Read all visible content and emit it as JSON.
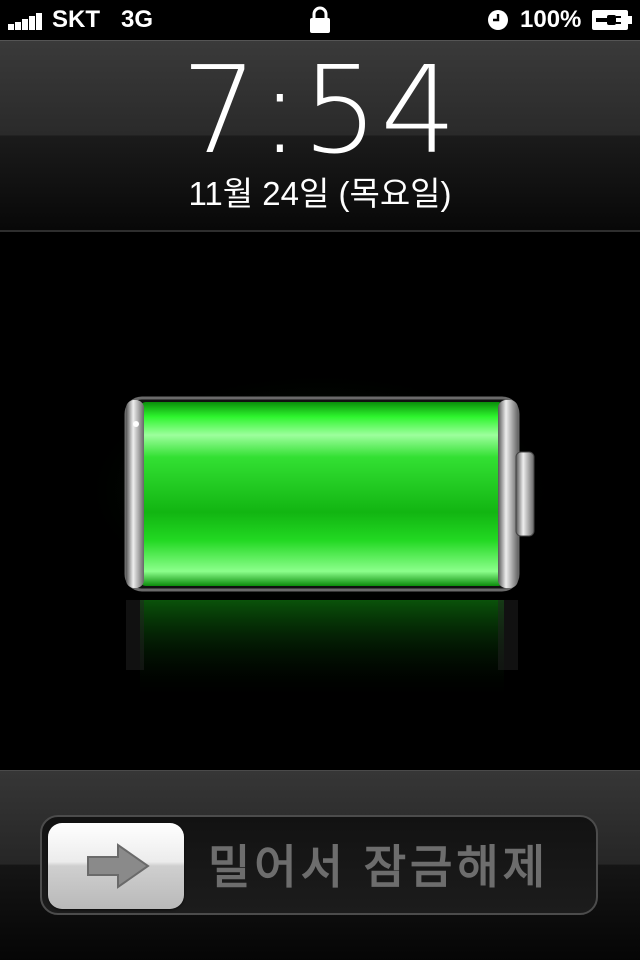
{
  "status_bar": {
    "carrier": "SKT",
    "network": "3G",
    "battery_percent": "100%",
    "signal_bars": 5,
    "icons": [
      "signal-bars-icon",
      "lock-icon",
      "alarm-clock-icon",
      "charging-battery-icon"
    ]
  },
  "lock_screen": {
    "time": "7:54",
    "date": "11월 24일 (목요일)",
    "battery_level": 1.0,
    "battery_color": "#19e619",
    "slider_label": "밀어서 잠금해제",
    "slider_icon": "right-arrow-icon"
  }
}
